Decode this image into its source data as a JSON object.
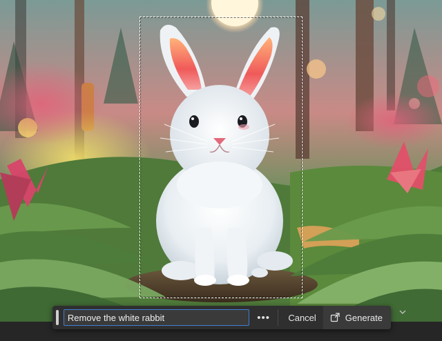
{
  "canvas": {
    "image_subject": "white-rabbit-in-forest-illustration"
  },
  "prompt_bar": {
    "input_value": "Remove the white rabbit",
    "more_label": "•••",
    "cancel_label": "Cancel",
    "generate_label": "Generate",
    "generate_icon": "generate-icon"
  },
  "colors": {
    "accent": "#3f7fd6",
    "bar_background": "#2f2f2f"
  }
}
